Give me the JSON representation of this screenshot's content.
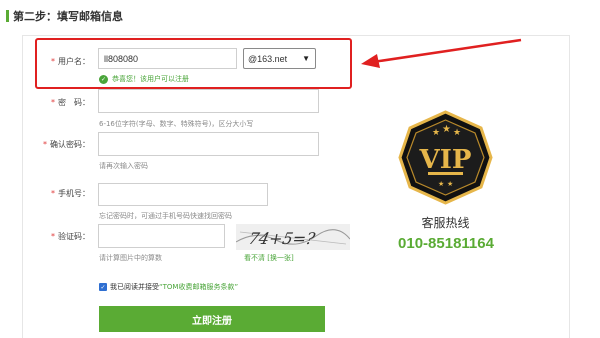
{
  "step": {
    "title": "第二步：填写邮箱信息"
  },
  "form": {
    "username": {
      "label": "用户名：",
      "value": "ll808080",
      "domain": "@163.net",
      "success": "恭喜您！该用户可以注册"
    },
    "password": {
      "label": "密　码：",
      "hint": "6-16位字符(字母、数字、特殊符号)，区分大小写"
    },
    "confirm": {
      "label": "确认密码：",
      "hint": "请再次输入密码"
    },
    "phone": {
      "label": "手机号：",
      "hint": "忘记密码时，可通过手机号码快速找回密码"
    },
    "captcha": {
      "label": "验证码：",
      "hint": "请计算图片中的算数",
      "refresh": "看不清 [换一张]",
      "image_text": "74+5=?"
    },
    "agreement": {
      "prefix": "我已阅读并接受",
      "link": "“TOM收费邮箱服务条款”"
    },
    "submit_label": "立即注册"
  },
  "sidebar": {
    "badge_text": "VIP",
    "hotline_label": "客服热线",
    "hotline_number": "010-85181164"
  },
  "colors": {
    "brand_green": "#5aab34",
    "highlight_red": "#e02020",
    "badge_gold": "#e6b64a"
  }
}
